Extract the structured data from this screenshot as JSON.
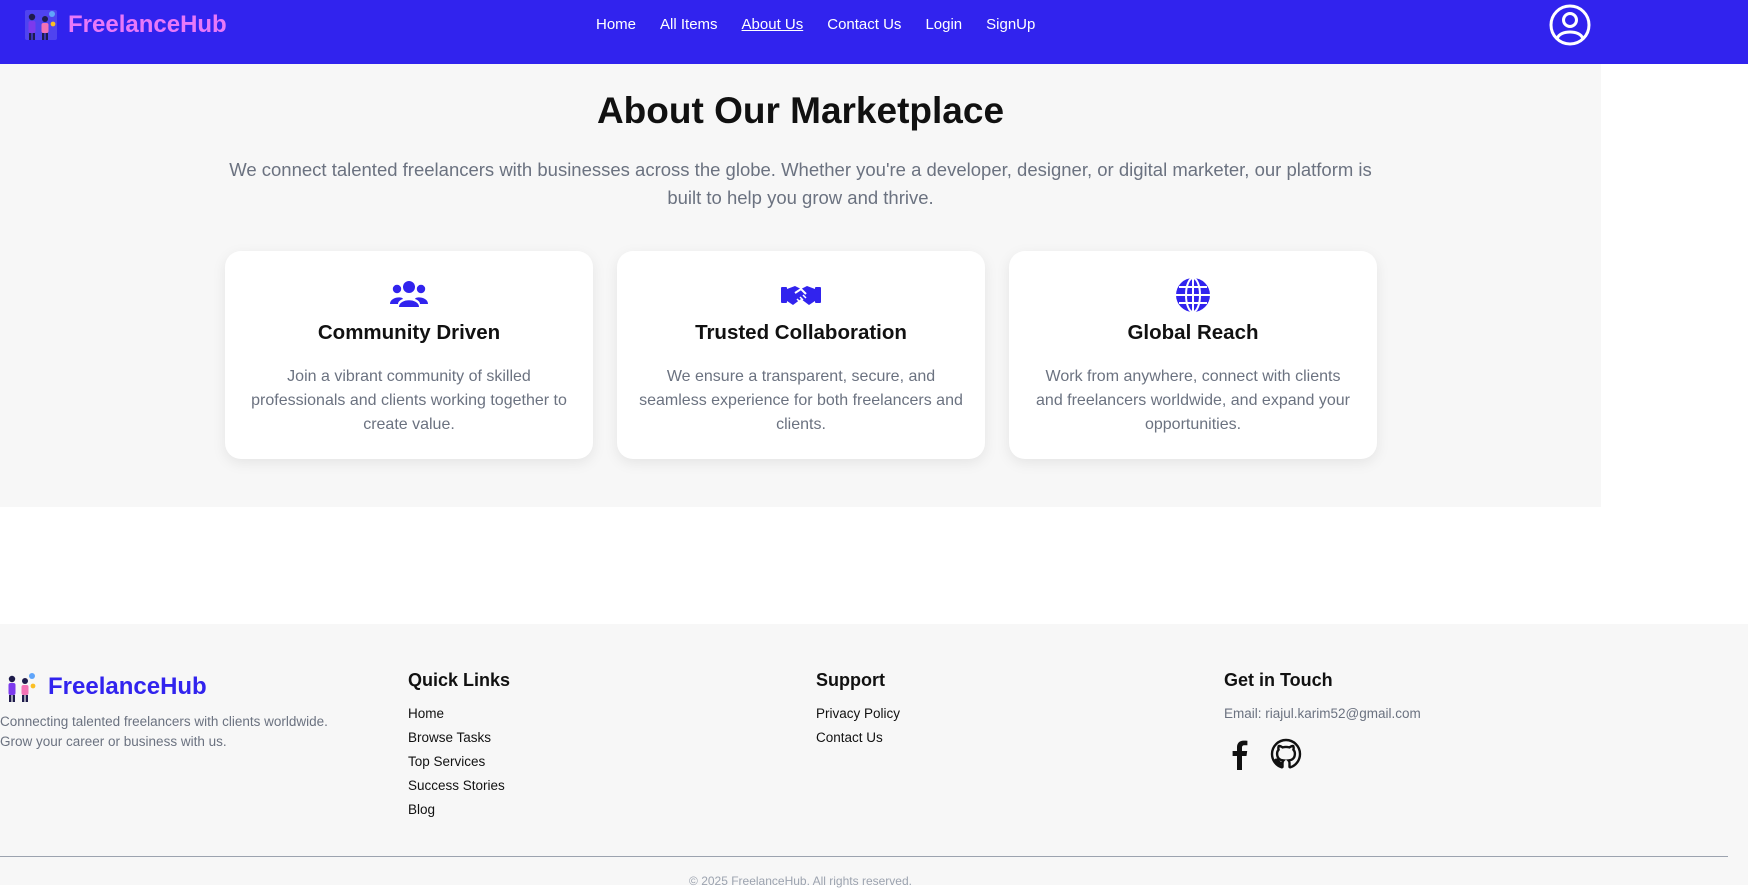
{
  "navbar": {
    "brand": "FreelanceHub",
    "links": [
      {
        "label": "Home"
      },
      {
        "label": "All Items"
      },
      {
        "label": "About Us"
      },
      {
        "label": "Contact Us"
      },
      {
        "label": "Login"
      },
      {
        "label": "SignUp"
      }
    ],
    "active_link": "About Us",
    "user_icon": "user-circle-icon"
  },
  "about": {
    "title": "About Our Marketplace",
    "description": "We connect talented freelancers with businesses across the globe. Whether you're a developer, designer, or digital marketer, our platform is built to help you grow and thrive.",
    "cards": [
      {
        "icon": "users-icon",
        "title": "Community Driven",
        "text": "Join a vibrant community of skilled professionals and clients working together to create value."
      },
      {
        "icon": "handshake-icon",
        "title": "Trusted Collaboration",
        "text": "We ensure a transparent, secure, and seamless experience for both freelancers and clients."
      },
      {
        "icon": "globe-icon",
        "title": "Global Reach",
        "text": "Work from anywhere, connect with clients and freelancers worldwide, and expand your opportunities."
      }
    ]
  },
  "footer": {
    "brand": "FreelanceHub",
    "tagline": "Connecting talented freelancers with clients worldwide. Grow your career or business with us.",
    "quick_links": {
      "heading": "Quick Links",
      "items": [
        "Home",
        "Browse Tasks",
        "Top Services",
        "Success Stories",
        "Blog"
      ]
    },
    "support": {
      "heading": "Support",
      "items": [
        "Privacy Policy",
        "Contact Us"
      ]
    },
    "contact": {
      "heading": "Get in Touch",
      "email": "Email: riajul.karim52@gmail.com",
      "socials": [
        "facebook-icon",
        "github-icon"
      ]
    },
    "copyright": "© 2025 FreelanceHub. All rights reserved."
  },
  "colors": {
    "primary": "#3123ee",
    "brand_accent": "#e879f9",
    "muted_text": "#6b7280",
    "section_bg": "#f7f7f7"
  }
}
